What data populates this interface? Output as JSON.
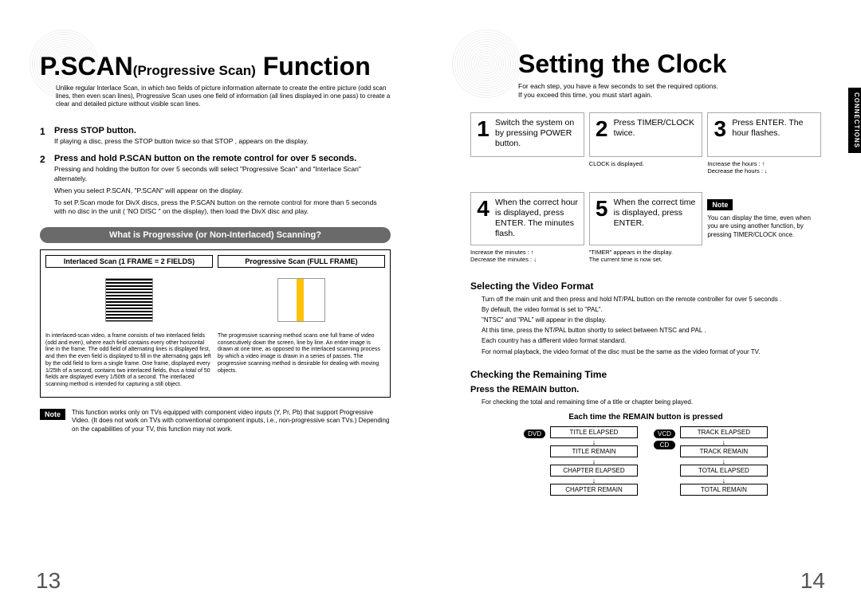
{
  "left": {
    "title_html": {
      "big": "P.SCAN",
      "sub": "(Progressive Scan)",
      "tail": "Function"
    },
    "intro": "Unlike regular Interlace Scan, in which two fields of picture information alternate to create the entire picture (odd scan lines, then even scan lines), Progressive Scan uses one field of information (all lines displayed in one pass) to create a clear and detailed picture without visible scan lines.",
    "steps": [
      {
        "num": "1",
        "head": "Press STOP button.",
        "body": "If playing a disc, press the STOP button twice so that STOP , appears on the display."
      },
      {
        "num": "2",
        "head": "Press and hold P.SCAN button on the remote control for over 5 seconds.",
        "body": "Pressing and holding the button for over 5 seconds will select \"Progressive Scan\" and \"Interlace Scan\" alternately.",
        "bullets": [
          "When you select P.SCAN, \"P.SCAN\" will appear on the display.",
          "To set P.Scan mode for DivX discs, press the P.SCAN button on the remote control for more than 5 seconds with no disc in the unit ( 'NO DISC \" on the display), then load the DivX disc and play."
        ]
      }
    ],
    "bar": "What is Progressive (or Non-Interlaced) Scanning?",
    "scan": {
      "left_head": "Interlaced Scan (1 FRAME = 2 FIELDS)",
      "right_head": "Progressive Scan (FULL FRAME)",
      "left_text": "In interlaced-scan video, a frame consists of two interlaced fields (odd and even), where each field contains every other horizontal line in the frame. The odd field of alternating lines is displayed first, and then the even field is displayed to fill in the alternating gaps left by the odd field to form a single frame. One frame, displayed every 1/25th of a second, contains two interlaced fields, thus a total of 50 fields are displayed every 1/50th of a second. The interlaced scanning method is intended for capturing a still object.",
      "right_text": "The progressive scanning method scans one full frame of video consecutively down the screen, line by line. An entire image is drawn at one time, as opposed to the interlaced scanning process by which a video image is drawn in a series of passes. The progressive scanning method is desirable for dealing with moving objects."
    },
    "note_label": "Note",
    "note_text": "This function works only on TVs equipped with component video inputs (Y, Pr, Pb) that support Progressive Video. (It does not work on TVs with conventional component inputs, i.e., non-progressive scan TVs.) Depending on the capabilities of your TV, this function may not work.",
    "page_num": "13"
  },
  "right": {
    "side_tab": "CONNECTIONS",
    "title": "Setting the Clock",
    "intro": "For each step, you have a few seconds to set the required options.\nIf you exceed this time, you must start again.",
    "steps_row1": [
      {
        "num": "1",
        "txt": "Switch the system on by pressing POWER button.",
        "sub": ""
      },
      {
        "num": "2",
        "txt": "Press TIMER/CLOCK twice.",
        "sub": "CLOCK is displayed."
      },
      {
        "num": "3",
        "txt": "Press ENTER. The hour flashes.",
        "sub": "Increase the hours : ↑\nDecrease the hours : ↓"
      }
    ],
    "steps_row2": [
      {
        "num": "4",
        "txt": "When the correct hour is displayed, press ENTER. The minutes flash.",
        "sub": "Increase the minutes : ↑\nDecrease the minutes : ↓"
      },
      {
        "num": "5",
        "txt": "When the correct time is displayed, press ENTER.",
        "sub": "\"TIMER\" appears in the display.\nThe current time is now set."
      },
      {
        "num": "",
        "txt": "",
        "sub": "",
        "is_note": true
      }
    ],
    "step_note_label": "Note",
    "step_note_text": "You can display the time, even when you are using another function, by pressing TIMER/CLOCK once.",
    "video_format": {
      "head": "Selecting the Video Format",
      "lines": [
        "Turn off the main unit and then press and hold NT/PAL button on the remote controller for over 5 seconds .",
        "By default, the video format is set to \"PAL\".",
        "\"NTSC\" and \"PAL\" will appear in the display.",
        "At this time, press the NT/PAL button shortly to select between NTSC and PAL .",
        "Each country has a different video format standard.",
        "For normal playback, the video format of the disc must be the same as the video format of your TV."
      ]
    },
    "remaining": {
      "head": "Checking the Remaining Time",
      "sub": "Press the REMAIN button.",
      "desc": "For checking the total and remaining time of a title or chapter being played.",
      "title": "Each time the REMAIN button is pressed",
      "left_badge": "DVD",
      "left_list": [
        "TITLE ELAPSED",
        "TITLE REMAIN",
        "CHAPTER ELAPSED",
        "CHAPTER REMAIN"
      ],
      "right_badges": [
        "VCD",
        "CD"
      ],
      "right_list": [
        "TRACK ELAPSED",
        "TRACK REMAIN",
        "TOTAL ELAPSED",
        "TOTAL REMAIN"
      ]
    },
    "page_num": "14"
  }
}
